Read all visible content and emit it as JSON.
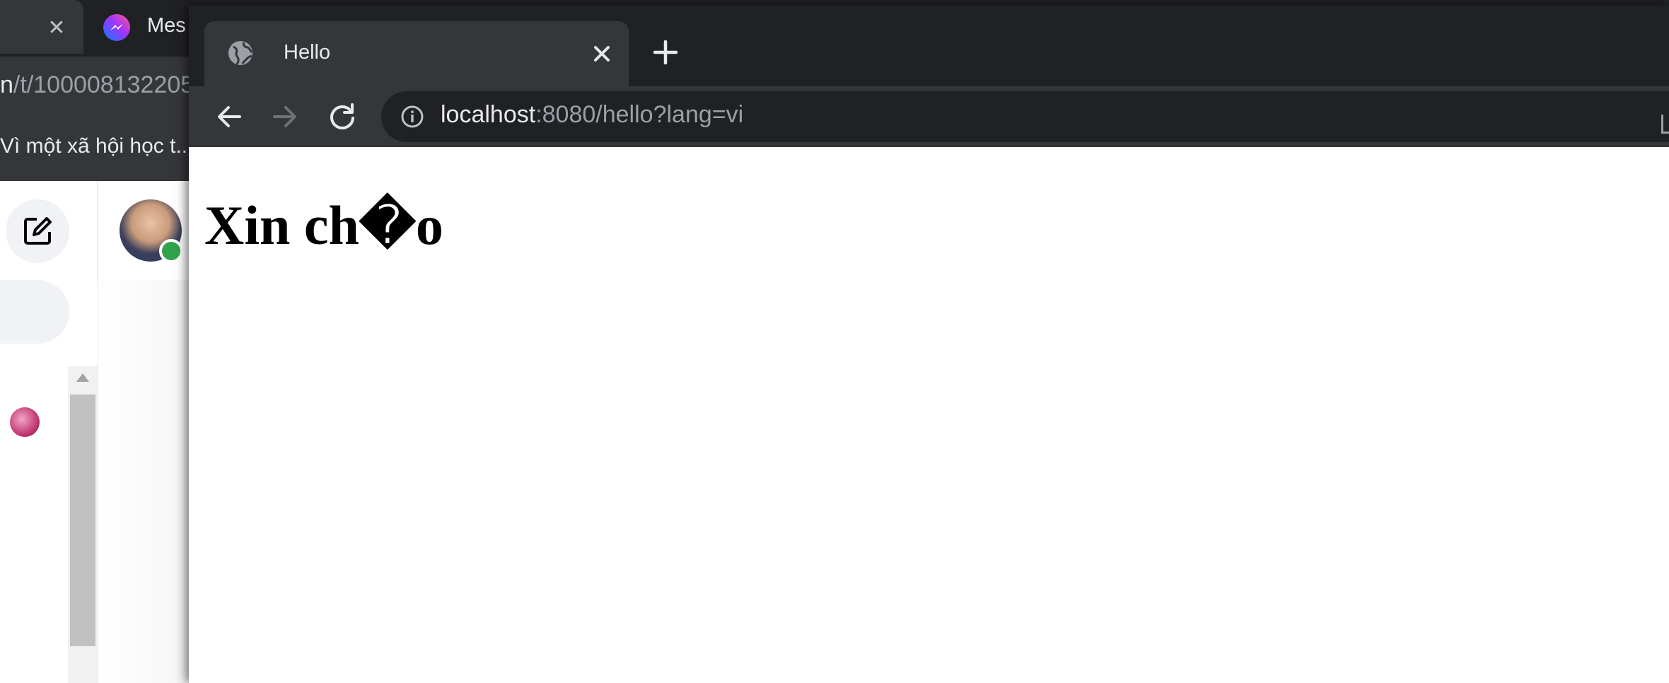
{
  "background_window": {
    "tab_prev_close": "✕",
    "messenger_tab_title": "Mes",
    "url_host_fragment": "n",
    "url_path": "/t/100008132205",
    "bookmark": "Vì một xã hội học t..."
  },
  "foreground_window": {
    "tab": {
      "title": "Hello"
    },
    "address_bar": {
      "host": "localhost",
      "rest": ":8080/hello?lang=vi"
    },
    "page": {
      "heading": "Xin ch�o"
    }
  },
  "colors": {
    "tabstrip_bg": "#202124",
    "toolbar_bg": "#35363a",
    "omnibox_bg": "#202124",
    "text_light": "#e8eaed",
    "text_muted": "#9aa0a6",
    "online_green": "#31a24c"
  },
  "icons": {
    "tab_favicon": "globe-icon",
    "tab_close": "close-icon",
    "new_tab": "plus-icon",
    "back": "arrow-left-icon",
    "forward": "arrow-right-icon",
    "reload": "reload-icon",
    "site_info": "info-icon",
    "compose": "compose-icon",
    "messenger_logo": "messenger-icon"
  }
}
